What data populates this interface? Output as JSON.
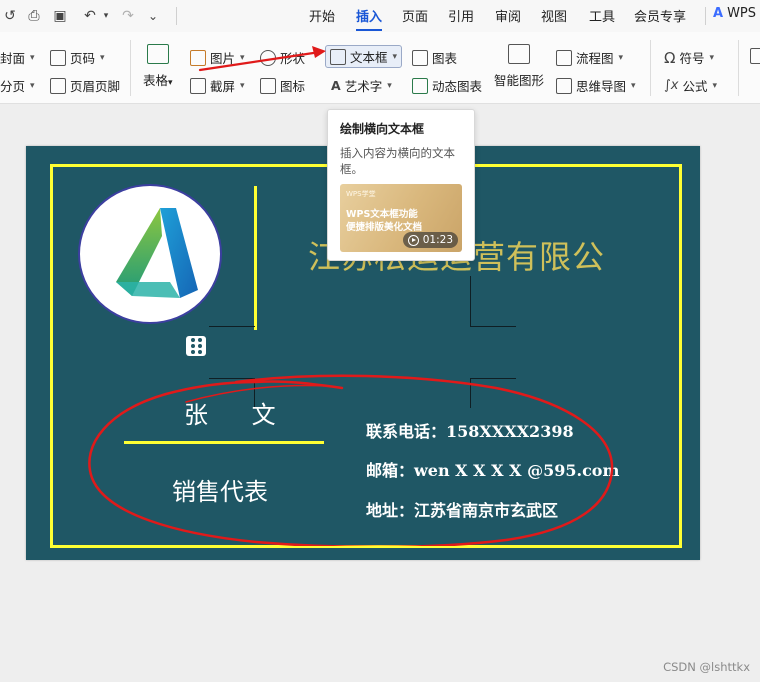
{
  "menubar": {
    "tabs": [
      "开始",
      "插入",
      "页面",
      "引用",
      "审阅",
      "视图",
      "工具",
      "会员专享"
    ],
    "active_tab": "插入",
    "brand": "WPS",
    "accent_color": "#1a57d6"
  },
  "ribbon": {
    "cover": "封面",
    "page_number": "页码",
    "page_break": "分页",
    "header_footer": "页眉页脚",
    "table": "表格",
    "picture": "图片",
    "screenshot": "截屏",
    "shape": "形状",
    "icon": "图标",
    "textbox": "文本框",
    "wordart": "艺术字",
    "chart": "图表",
    "dynamic_chart": "动态图表",
    "smart_graphic": "智能图形",
    "flowchart": "流程图",
    "mindmap": "思维导图",
    "symbol": "符号",
    "formula": "公式"
  },
  "tooltip": {
    "title": "绘制横向文本框",
    "description": "插入内容为横向的文本框。",
    "video": {
      "brand": "WPS学堂",
      "line1": "WPS文本框功能",
      "line2": "便捷排版美化文档",
      "duration": "01:23"
    }
  },
  "card": {
    "company": "江苏松运运营有限公",
    "name": "张 文",
    "title": "销售代表",
    "phone": "联系电话：158XXXX2398",
    "email": "邮箱：wen X X X X @595.com",
    "address": "地址：江苏省南京市玄武区",
    "background_color": "#1f5765",
    "border_color": "#ffff33",
    "annotation_color": "#e01a1a"
  },
  "watermark": "CSDN @lshttkx"
}
